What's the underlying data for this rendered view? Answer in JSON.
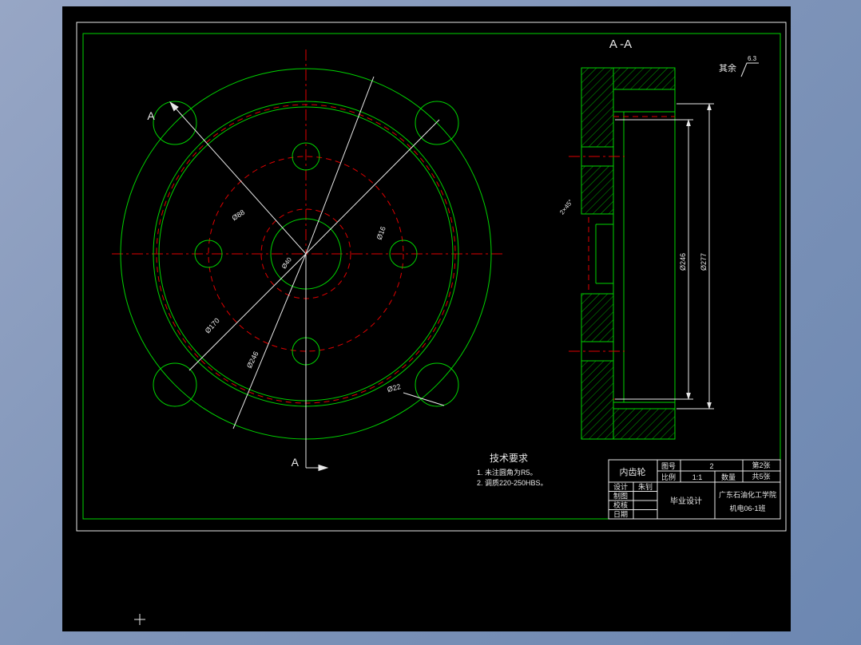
{
  "colors": {
    "line_green": "#00d400",
    "line_red": "#e00000",
    "line_white": "#e8e8e8",
    "canvas_black": "#000000"
  },
  "front_view": {
    "section_label_top": "A",
    "section_label_bottom": "A",
    "dim_hub": "Ø40",
    "dim_bore": "Ø88",
    "dim_hole": "Ø16",
    "dim_pitch": "Ø170",
    "dim_ring": "Ø246",
    "dim_notch": "Ø22"
  },
  "section_view": {
    "title": "A -A",
    "dim_inner": "Ø246",
    "dim_outer": "Ø277",
    "chamfer": "2×45°"
  },
  "surface_note": {
    "label": "其余",
    "value": "6.3"
  },
  "tech_requirements": {
    "title": "技术要求",
    "items": [
      "1. 未注圆角为R5。",
      "2. 调质220-250HBS。"
    ]
  },
  "title_block": {
    "part_name": "内齿轮",
    "drawing_no_label": "图号",
    "drawing_no": "2",
    "scale_label": "比例",
    "scale_value": "1:1",
    "qty_label": "数量",
    "sheet_no": "第2张",
    "sheet_total": "共5张",
    "rows": [
      {
        "label": "设计",
        "value": "朱钊"
      },
      {
        "label": "制图",
        "value": ""
      },
      {
        "label": "校核",
        "value": ""
      },
      {
        "label": "日期",
        "value": ""
      }
    ],
    "project": "毕业设计",
    "school": "广东石油化工学院",
    "class_name": "机电06-1班"
  }
}
